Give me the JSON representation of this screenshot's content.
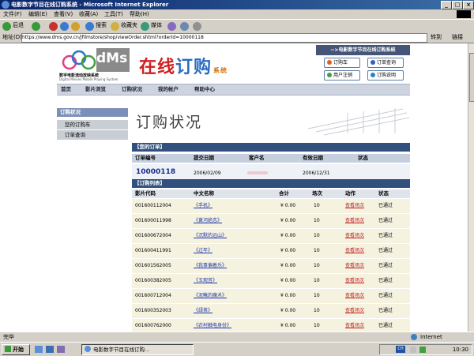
{
  "window": {
    "title": "电影数字节目在线订购系统 - Microsoft Internet Explorer"
  },
  "menu": [
    "文件(F)",
    "编辑(E)",
    "查看(V)",
    "收藏(A)",
    "工具(T)",
    "帮助(H)"
  ],
  "toolbar": {
    "back": "后退",
    "search": "搜索",
    "favorites": "收藏夹",
    "media": "媒体"
  },
  "address": {
    "label": "地址(D)",
    "url": "https://www.dms.gov.cn/jfilmstore/shop/viewOrder.shtml?orderId=10000118",
    "go": "转到",
    "links": "链接"
  },
  "header": {
    "logo_letters": "dMs",
    "logo_cn": "数字电影流动放映系统",
    "logo_en": "Digital Movies Mobile Playing System",
    "site_title_1": "在线",
    "site_title_2": "订购",
    "site_title_3": "系统",
    "ribbon": "-->电影数字节目在线订购系统",
    "quick": [
      "订购车",
      "订单查询",
      "用户注销",
      "订购说明"
    ]
  },
  "nav": [
    "首页",
    "影片浏览",
    "订购状况",
    "我的帐户",
    "帮助中心"
  ],
  "sidebar": {
    "title": "订购状况",
    "items": [
      "您的订购车",
      "订单查询"
    ]
  },
  "page_title": "订购状况",
  "order_section": {
    "title": "【您的订单】",
    "headers": [
      "订单编号",
      "提交日期",
      "客户名",
      "有效日期",
      "状态"
    ],
    "order_id": "10000118",
    "submit_date": "2006/02/09",
    "valid_date": "2006/12/31"
  },
  "list_section": {
    "title": "【订购列表】",
    "headers": [
      "影片代码",
      "中文名称",
      "合计",
      "场次",
      "动作",
      "状态"
    ],
    "rows": [
      {
        "code": "001600112004",
        "name": "《手机》",
        "total": "¥ 0.00",
        "count": "10",
        "action": "查看场次",
        "status": "已通过"
      },
      {
        "code": "001600011998",
        "name": "《黄河绝恋》",
        "total": "¥ 0.00",
        "count": "10",
        "action": "查看场次",
        "status": "已通过"
      },
      {
        "code": "001600672004",
        "name": "《沉默的远山》",
        "total": "¥ 0.00",
        "count": "10",
        "action": "查看场次",
        "status": "已通过"
      },
      {
        "code": "001600411991",
        "name": "《过年》",
        "total": "¥ 0.00",
        "count": "10",
        "action": "查看场次",
        "status": "已通过"
      },
      {
        "code": "001601562005",
        "name": "《我事偏着乐》",
        "total": "¥ 0.00",
        "count": "10",
        "action": "查看场次",
        "status": "已通过"
      },
      {
        "code": "001600382005",
        "name": "《玉观音》",
        "total": "¥ 0.00",
        "count": "10",
        "action": "查看场次",
        "status": "已通过"
      },
      {
        "code": "001600712004",
        "name": "《泥鳅的魔术》",
        "total": "¥ 0.00",
        "count": "10",
        "action": "查看场次",
        "status": "已通过"
      },
      {
        "code": "001600352003",
        "name": "《绿茶》",
        "total": "¥ 0.00",
        "count": "10",
        "action": "查看场次",
        "status": "已通过"
      },
      {
        "code": "001600762000",
        "name": "《农村触电身份》",
        "total": "¥ 0.00",
        "count": "10",
        "action": "查看场次",
        "status": "已通过"
      }
    ]
  },
  "status_bar": {
    "left": "完毕",
    "zone": "Internet"
  },
  "taskbar": {
    "start": "开始",
    "task": "电影数字节目在线订购...",
    "clock": "10:30",
    "ime": "CH"
  },
  "colors": {
    "title_blue": "#0a246a",
    "section_blue": "#32507e",
    "title_red": "#d02020",
    "title_blue_text": "#2a6cc0",
    "link_blue": "#2038a8",
    "action_red": "#c02020"
  }
}
